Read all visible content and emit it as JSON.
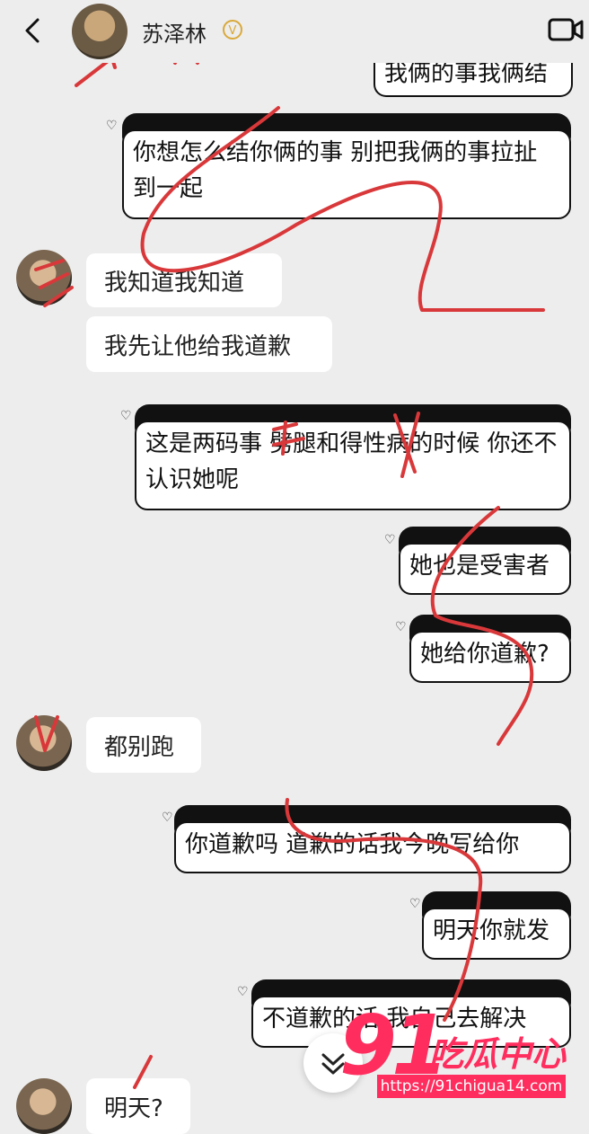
{
  "header": {
    "back_icon": "chevron-left-icon",
    "contact_name": "苏泽林",
    "verified_badge": "V",
    "video_icon": "video-camera-icon"
  },
  "messages": [
    {
      "side": "right",
      "text": "我俩的事我俩结",
      "partial": true
    },
    {
      "side": "right",
      "text": "你想怎么结你俩的事  别把我俩的事拉扯到一起"
    },
    {
      "side": "left",
      "text": "我知道我知道"
    },
    {
      "side": "left",
      "text": "我先让他给我道歉"
    },
    {
      "side": "right",
      "text": "这是两码事  劈腿和得性病的时候  你还不认识她呢"
    },
    {
      "side": "right",
      "text": "她也是受害者"
    },
    {
      "side": "right",
      "text": "她给你道歉?"
    },
    {
      "side": "left",
      "text": "都别跑"
    },
    {
      "side": "right",
      "text": "你道歉吗  道歉的话我今晚写给你"
    },
    {
      "side": "right",
      "text": "明天你就发"
    },
    {
      "side": "right",
      "text": "不道歉的话  我自己去解决"
    },
    {
      "side": "left",
      "text": "明天?",
      "partial": true
    }
  ],
  "scroll_button": {
    "icon": "double-chevron-down-icon"
  },
  "watermark": {
    "logo_number": "91",
    "logo_text": "吃瓜中心",
    "url": "https://91chigua14.com"
  },
  "colors": {
    "background": "#ededed",
    "bubble": "#ffffff",
    "scribble": "#d9383a",
    "watermark": "#ff2d5e",
    "verified": "#d9a93a"
  }
}
